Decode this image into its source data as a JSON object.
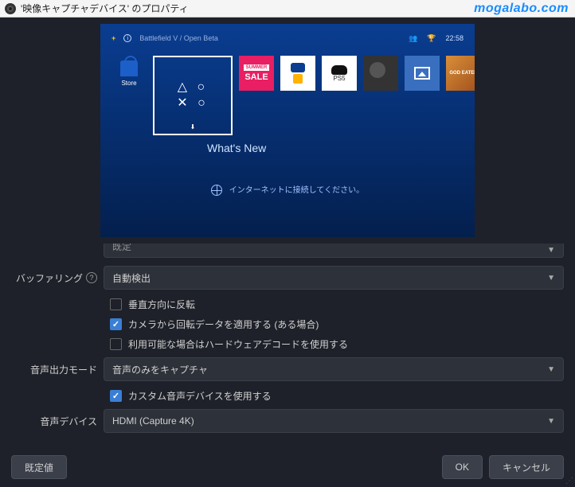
{
  "window": {
    "title": "'映像キャプチャデバイス' のプロパティ",
    "watermark": "mogalabo.com"
  },
  "preview": {
    "top_title": "Battlefield V / Open Beta",
    "clock": "22:58",
    "store_label": "Store",
    "sale_tag": "SUMMER",
    "sale_text": "SALE",
    "psplus_label": "PS Plus",
    "ps5_label": "PS5",
    "god_label": "GOD EATER",
    "whats_new": "What's New",
    "net_msg": "インターネットに接続してください。"
  },
  "form": {
    "hidden_value": "既定",
    "buffering_label": "バッファリング",
    "buffering_value": "自動検出",
    "flip_label": "垂直方向に反転",
    "rotation_label": "カメラから回転データを適用する (ある場合)",
    "hwdecode_label": "利用可能な場合はハードウェアデコードを使用する",
    "audio_mode_label": "音声出力モード",
    "audio_mode_value": "音声のみをキャプチャ",
    "custom_audio_label": "カスタム音声デバイスを使用する",
    "audio_device_label": "音声デバイス",
    "audio_device_value": "HDMI (Capture 4K)"
  },
  "buttons": {
    "defaults": "既定値",
    "ok": "OK",
    "cancel": "キャンセル"
  }
}
